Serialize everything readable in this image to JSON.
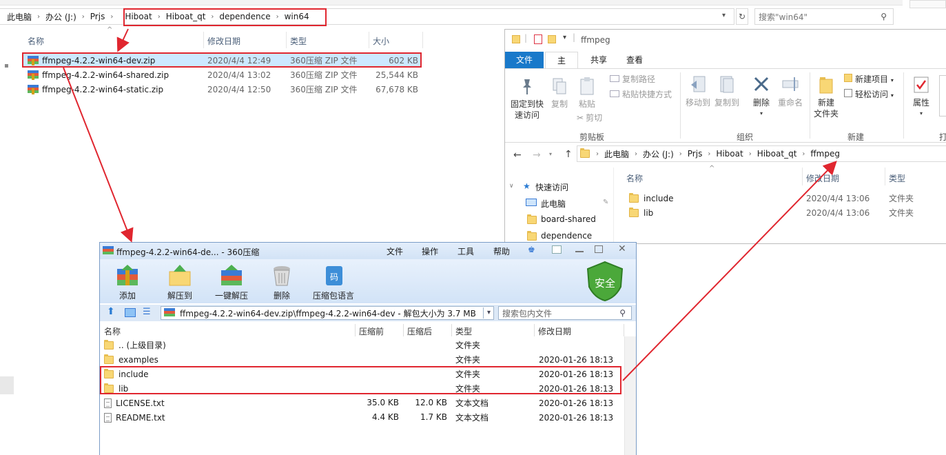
{
  "bg": {
    "breadcrumb": [
      "此电脑",
      "办公 (J:)",
      "Prjs",
      "Hiboat",
      "Hiboat_qt",
      "dependence",
      "win64"
    ],
    "search_placeholder": "搜索\"win64\"",
    "columns": {
      "name": "名称",
      "date": "修改日期",
      "type": "类型",
      "size": "大小"
    },
    "files": [
      {
        "name": "ffmpeg-4.2.2-win64-dev.zip",
        "date": "2020/4/4 12:49",
        "type": "360压缩 ZIP 文件",
        "size": "602 KB"
      },
      {
        "name": "ffmpeg-4.2.2-win64-shared.zip",
        "date": "2020/4/4 13:02",
        "type": "360压缩 ZIP 文件",
        "size": "25,544 KB"
      },
      {
        "name": "ffmpeg-4.2.2-win64-static.zip",
        "date": "2020/4/4 12:50",
        "type": "360压缩 ZIP 文件",
        "size": "67,678 KB"
      }
    ]
  },
  "right": {
    "title": "ffmpeg",
    "tabs": {
      "file": "文件",
      "home": "主页",
      "share": "共享",
      "view": "查看"
    },
    "ribbon": {
      "pin": "固定到快\n速访问",
      "copy": "复制",
      "paste": "粘贴",
      "copy_path": "复制路径",
      "paste_shortcut": "粘贴快捷方式",
      "cut": "剪切",
      "clipboard": "剪贴板",
      "move_to": "移动到",
      "copy_to": "复制到",
      "delete": "删除",
      "rename": "重命名",
      "organize": "组织",
      "new_folder": "新建\n文件夹",
      "new_item": "新建项目",
      "easy_access": "轻松访问",
      "new_group": "新建",
      "properties": "属性",
      "open_partial": "打"
    },
    "breadcrumb": [
      "此电脑",
      "办公 (J:)",
      "Prjs",
      "Hiboat",
      "Hiboat_qt",
      "ffmpeg"
    ],
    "nav": [
      {
        "label": "快速访问"
      },
      {
        "label": "此电脑"
      },
      {
        "label": "board-shared"
      },
      {
        "label": "dependence"
      }
    ],
    "columns": {
      "name": "名称",
      "date": "修改日期",
      "type": "类型"
    },
    "files": [
      {
        "name": "include",
        "date": "2020/4/4 13:06",
        "type": "文件夹"
      },
      {
        "name": "lib",
        "date": "2020/4/4 13:06",
        "type": "文件夹"
      }
    ]
  },
  "zip": {
    "title": "ffmpeg-4.2.2-win64-de... - 360压缩",
    "menu": [
      "文件",
      "操作",
      "工具",
      "帮助"
    ],
    "tools": {
      "add": "添加",
      "extract": "解压到",
      "oneclick": "一键解压",
      "delete": "删除",
      "lang": "压缩包语言"
    },
    "badge": "安全",
    "badge_glyph": "码",
    "path": "ffmpeg-4.2.2-win64-dev.zip\\ffmpeg-4.2.2-win64-dev - 解包大小为 3.7 MB",
    "search_placeholder": "搜索包内文件",
    "columns": {
      "name": "名称",
      "packed_before": "压缩前",
      "packed_after": "压缩后",
      "type": "类型",
      "date": "修改日期"
    },
    "rows": [
      {
        "name": ".. (上级目录)",
        "before": "",
        "after": "",
        "type": "文件夹",
        "date": ""
      },
      {
        "name": "examples",
        "before": "",
        "after": "",
        "type": "文件夹",
        "date": "2020-01-26 18:13"
      },
      {
        "name": "include",
        "before": "",
        "after": "",
        "type": "文件夹",
        "date": "2020-01-26 18:13"
      },
      {
        "name": "lib",
        "before": "",
        "after": "",
        "type": "文件夹",
        "date": "2020-01-26 18:13"
      },
      {
        "name": "LICENSE.txt",
        "before": "35.0 KB",
        "after": "12.0 KB",
        "type": "文本文档",
        "date": "2020-01-26 18:13"
      },
      {
        "name": "README.txt",
        "before": "4.4 KB",
        "after": "1.7 KB",
        "type": "文本文档",
        "date": "2020-01-26 18:13"
      }
    ]
  }
}
